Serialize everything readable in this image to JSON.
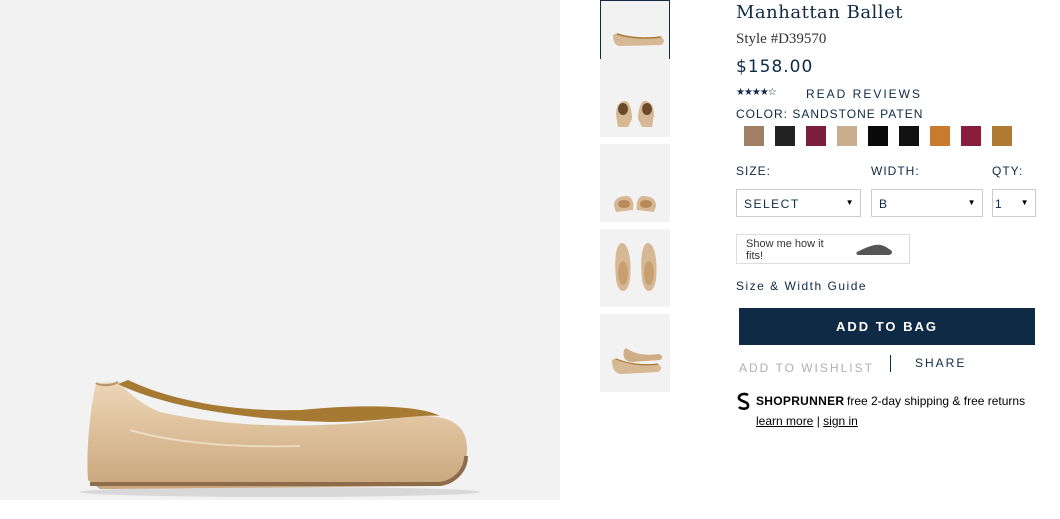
{
  "product": {
    "title": "Manhattan Ballet",
    "style": "Style #D39570",
    "price": "$158.00",
    "rating_stars": "★★★★☆",
    "rating_value": 4.5,
    "reviews_link": "READ REVIEWS",
    "color_label": "COLOR: SANDSTONE PATEN"
  },
  "swatches": [
    {
      "name": "swatch-1",
      "color": "#a08064"
    },
    {
      "name": "swatch-2",
      "color": "#222222"
    },
    {
      "name": "swatch-3",
      "color": "#7a1f3d"
    },
    {
      "name": "swatch-4",
      "color": "#c9ad8c"
    },
    {
      "name": "swatch-5",
      "color": "#0a0a0a"
    },
    {
      "name": "swatch-6",
      "color": "#111111"
    },
    {
      "name": "swatch-7",
      "color": "#c97a2e"
    },
    {
      "name": "swatch-8",
      "color": "#8a1e3a"
    },
    {
      "name": "swatch-9",
      "color": "#b07a30"
    }
  ],
  "options": {
    "size_label": "SIZE:",
    "size_value": "SELECT",
    "width_label": "WIDTH:",
    "width_value": "B",
    "qty_label": "QTY:",
    "qty_value": "1"
  },
  "fit_widget": {
    "text": "Show me how it fits!"
  },
  "size_guide": "Size & Width Guide",
  "add_to_bag": "ADD TO BAG",
  "add_to_wishlist": "ADD TO WISHLIST",
  "share": "SHARE",
  "shoprunner": {
    "brand": "SHOPRUNNER",
    "text": "free 2-day shipping & free returns",
    "learn_more": "learn more",
    "separator": "|",
    "sign_in": "sign in"
  },
  "colors": {
    "navy": "#0f2a44",
    "hero_bg": "#f2f2f2",
    "shoe": "#dcbf9c"
  }
}
